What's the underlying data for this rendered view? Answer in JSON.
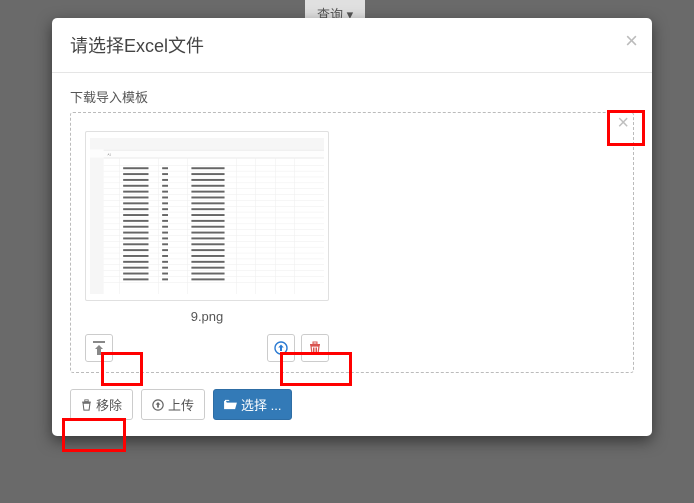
{
  "background_button": "查询",
  "modal": {
    "title": "请选择Excel文件",
    "close_glyph": "×",
    "sub_label": "下载导入模板",
    "dropzone": {
      "close_glyph": "×",
      "file": {
        "name": "9.png"
      }
    },
    "footer": {
      "remove_label": "移除",
      "upload_label": "上传",
      "select_label": "选择 ..."
    }
  }
}
